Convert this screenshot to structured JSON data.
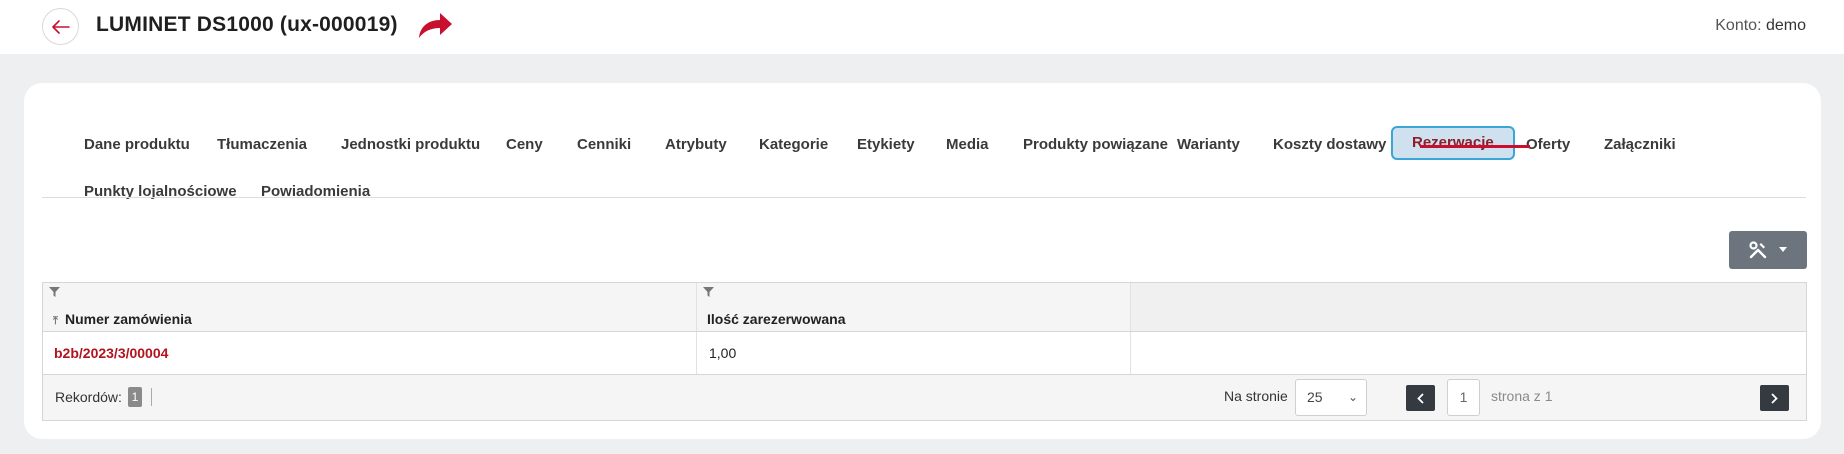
{
  "header": {
    "title": "LUMINET DS1000 (ux-000019)",
    "account_label": "Konto:",
    "account_user": "demo"
  },
  "tabs": [
    {
      "label": "Dane produktu"
    },
    {
      "label": "Tłumaczenia"
    },
    {
      "label": "Jednostki produktu"
    },
    {
      "label": "Ceny"
    },
    {
      "label": "Cenniki"
    },
    {
      "label": "Atrybuty"
    },
    {
      "label": "Kategorie"
    },
    {
      "label": "Etykiety"
    },
    {
      "label": "Media"
    },
    {
      "label": "Produkty powiązane"
    },
    {
      "label": "Warianty"
    },
    {
      "label": "Koszty dostawy"
    },
    {
      "label": "Rezerwacje",
      "active": true
    },
    {
      "label": "Oferty"
    },
    {
      "label": "Załączniki"
    },
    {
      "label": "Punkty lojalnościowe"
    },
    {
      "label": "Powiadomienia"
    }
  ],
  "grid": {
    "columns": [
      "Numer zamówienia",
      "Ilość zarezerwowana"
    ],
    "rows": [
      {
        "order_number": "b2b/2023/3/00004",
        "reserved_qty": "1,00"
      }
    ],
    "footer": {
      "records_label": "Rekordów:",
      "records_count": "1",
      "per_page_label": "Na stronie",
      "per_page_value": "25",
      "current_page": "1",
      "page_of": "strona z 1"
    }
  },
  "colors": {
    "accent_red": "#c8102e",
    "link_red": "#b3121f",
    "active_tab_bg": "#cfe0ef",
    "active_tab_border": "#39a6d6",
    "tools_btn": "#6c757d",
    "pager_btn": "#343a40"
  },
  "icons": {
    "back": "arrow-left-icon",
    "redirect": "redirect-arrow-icon",
    "tools": "wrench-screwdriver-icon",
    "filter": "filter-icon",
    "sort": "sort-asc-icon"
  }
}
